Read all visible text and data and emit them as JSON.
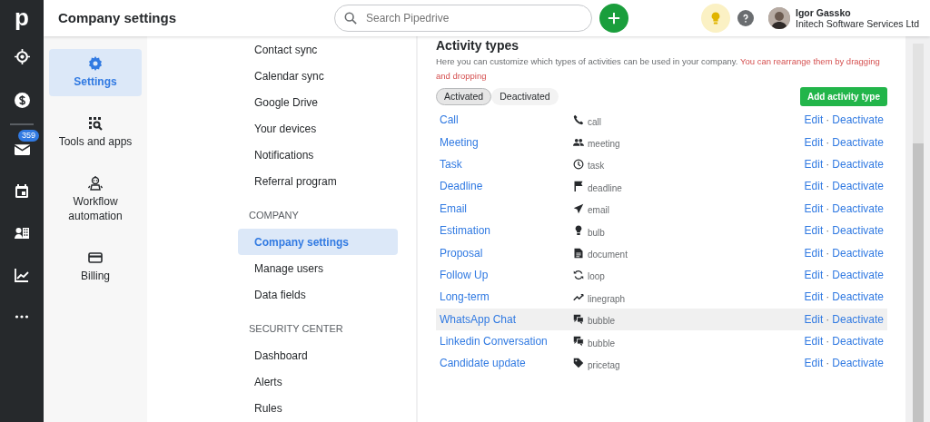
{
  "rail": {
    "logo": "p",
    "mail_badge": "359"
  },
  "header": {
    "title": "Company settings",
    "search": {
      "placeholder": "Search Pipedrive"
    },
    "user": {
      "name": "Igor Gassko",
      "company": "Initech Software Services Ltd"
    }
  },
  "settings_nav": [
    {
      "label": "Settings",
      "selected": true
    },
    {
      "label": "Tools and apps",
      "selected": false
    },
    {
      "label": "Workflow automation",
      "selected": false
    },
    {
      "label": "Billing",
      "selected": false
    }
  ],
  "submenu": [
    {
      "kind": "item",
      "label": "Contact sync",
      "selected": false
    },
    {
      "kind": "item",
      "label": "Calendar sync",
      "selected": false
    },
    {
      "kind": "item",
      "label": "Google Drive",
      "selected": false
    },
    {
      "kind": "item",
      "label": "Your devices",
      "selected": false
    },
    {
      "kind": "item",
      "label": "Notifications",
      "selected": false
    },
    {
      "kind": "item",
      "label": "Referral program",
      "selected": false
    },
    {
      "kind": "heading",
      "label": "COMPANY"
    },
    {
      "kind": "item",
      "label": "Company settings",
      "selected": true
    },
    {
      "kind": "item",
      "label": "Manage users",
      "selected": false
    },
    {
      "kind": "item",
      "label": "Data fields",
      "selected": false
    },
    {
      "kind": "heading",
      "label": "SECURITY CENTER"
    },
    {
      "kind": "item",
      "label": "Dashboard",
      "selected": false
    },
    {
      "kind": "item",
      "label": "Alerts",
      "selected": false
    },
    {
      "kind": "item",
      "label": "Rules",
      "selected": false
    }
  ],
  "activity_types": {
    "title": "Activity types",
    "description": "Here you can customize which types of activities can be used in your company.",
    "hint": "You can rearrange them by dragging and dropping",
    "tabs": [
      {
        "label": "Activated",
        "selected": true
      },
      {
        "label": "Deactivated",
        "selected": false
      }
    ],
    "add_button": "Add activity type",
    "rows": [
      {
        "name": "Call",
        "icon_label": "call",
        "edit": "Edit",
        "separator": "·",
        "deactivate": "Deactivate",
        "highlighted": false
      },
      {
        "name": "Meeting",
        "icon_label": "meeting",
        "edit": "Edit",
        "separator": "·",
        "deactivate": "Deactivate",
        "highlighted": false
      },
      {
        "name": "Task",
        "icon_label": "task",
        "edit": "Edit",
        "separator": "·",
        "deactivate": "Deactivate",
        "highlighted": false
      },
      {
        "name": "Deadline",
        "icon_label": "deadline",
        "edit": "Edit",
        "separator": "·",
        "deactivate": "Deactivate",
        "highlighted": false
      },
      {
        "name": "Email",
        "icon_label": "email",
        "edit": "Edit",
        "separator": "·",
        "deactivate": "Deactivate",
        "highlighted": false
      },
      {
        "name": "Estimation",
        "icon_label": "bulb",
        "edit": "Edit",
        "separator": "·",
        "deactivate": "Deactivate",
        "highlighted": false
      },
      {
        "name": "Proposal",
        "icon_label": "document",
        "edit": "Edit",
        "separator": "·",
        "deactivate": "Deactivate",
        "highlighted": false
      },
      {
        "name": "Follow Up",
        "icon_label": "loop",
        "edit": "Edit",
        "separator": "·",
        "deactivate": "Deactivate",
        "highlighted": false
      },
      {
        "name": "Long-term",
        "icon_label": "linegraph",
        "edit": "Edit",
        "separator": "·",
        "deactivate": "Deactivate",
        "highlighted": false
      },
      {
        "name": "WhatsApp Chat",
        "icon_label": "bubble",
        "edit": "Edit",
        "separator": "·",
        "deactivate": "Deactivate",
        "highlighted": true
      },
      {
        "name": "Linkedin Conversation",
        "icon_label": "bubble",
        "edit": "Edit",
        "separator": "·",
        "deactivate": "Deactivate",
        "highlighted": false
      },
      {
        "name": "Candidate update",
        "icon_label": "pricetag",
        "edit": "Edit",
        "separator": "·",
        "deactivate": "Deactivate",
        "highlighted": false
      }
    ]
  }
}
